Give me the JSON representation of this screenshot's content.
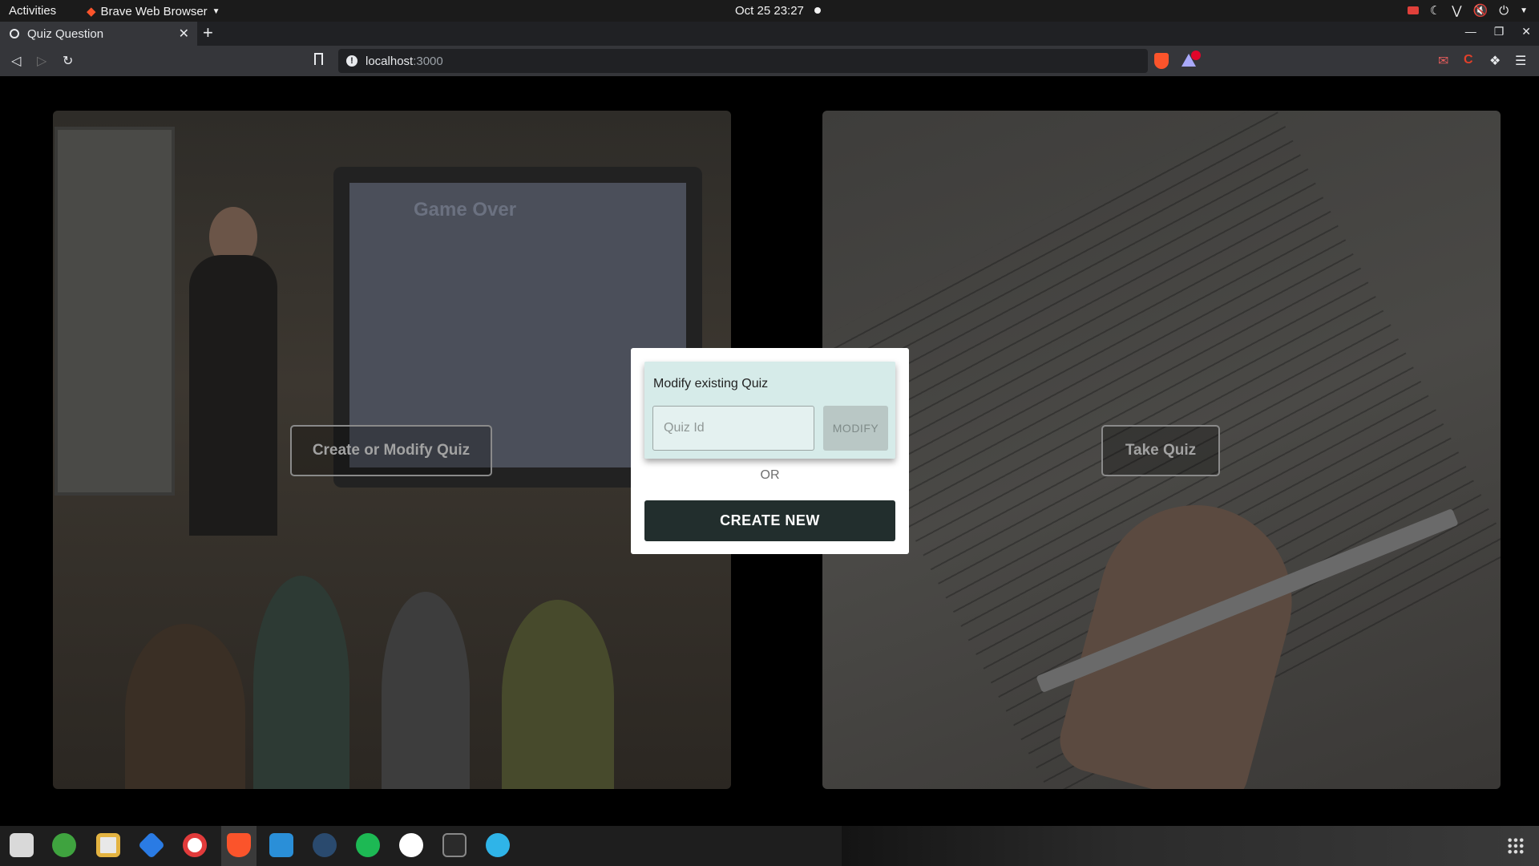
{
  "topbar": {
    "activities": "Activities",
    "app_name": "Brave Web Browser",
    "datetime": "Oct 25  23:27"
  },
  "browser": {
    "tab_title": "Quiz Question",
    "url_host": "localhost",
    "url_port": ":3000"
  },
  "page": {
    "create_modify_label": "Create or Modify Quiz",
    "take_quiz_label": "Take Quiz",
    "slide_title": "Game Over"
  },
  "modal": {
    "modify_title": "Modify existing Quiz",
    "quiz_id_placeholder": "Quiz Id",
    "modify_button": "MODIFY",
    "or_text": "OR",
    "create_new_button": "CREATE NEW"
  },
  "colors": {
    "modify_box_bg": "#d6ebe9",
    "create_new_bg": "#222e2d",
    "brave_orange": "#fb542b"
  },
  "dock": {
    "apps": [
      "files-icon",
      "utorrent-icon",
      "rhythmbox-icon",
      "vpn-icon",
      "help-icon",
      "brave-icon",
      "vscode-icon",
      "steam-icon",
      "spotify-icon",
      "mongodb-icon",
      "terminal-icon",
      "settings-icon"
    ]
  }
}
